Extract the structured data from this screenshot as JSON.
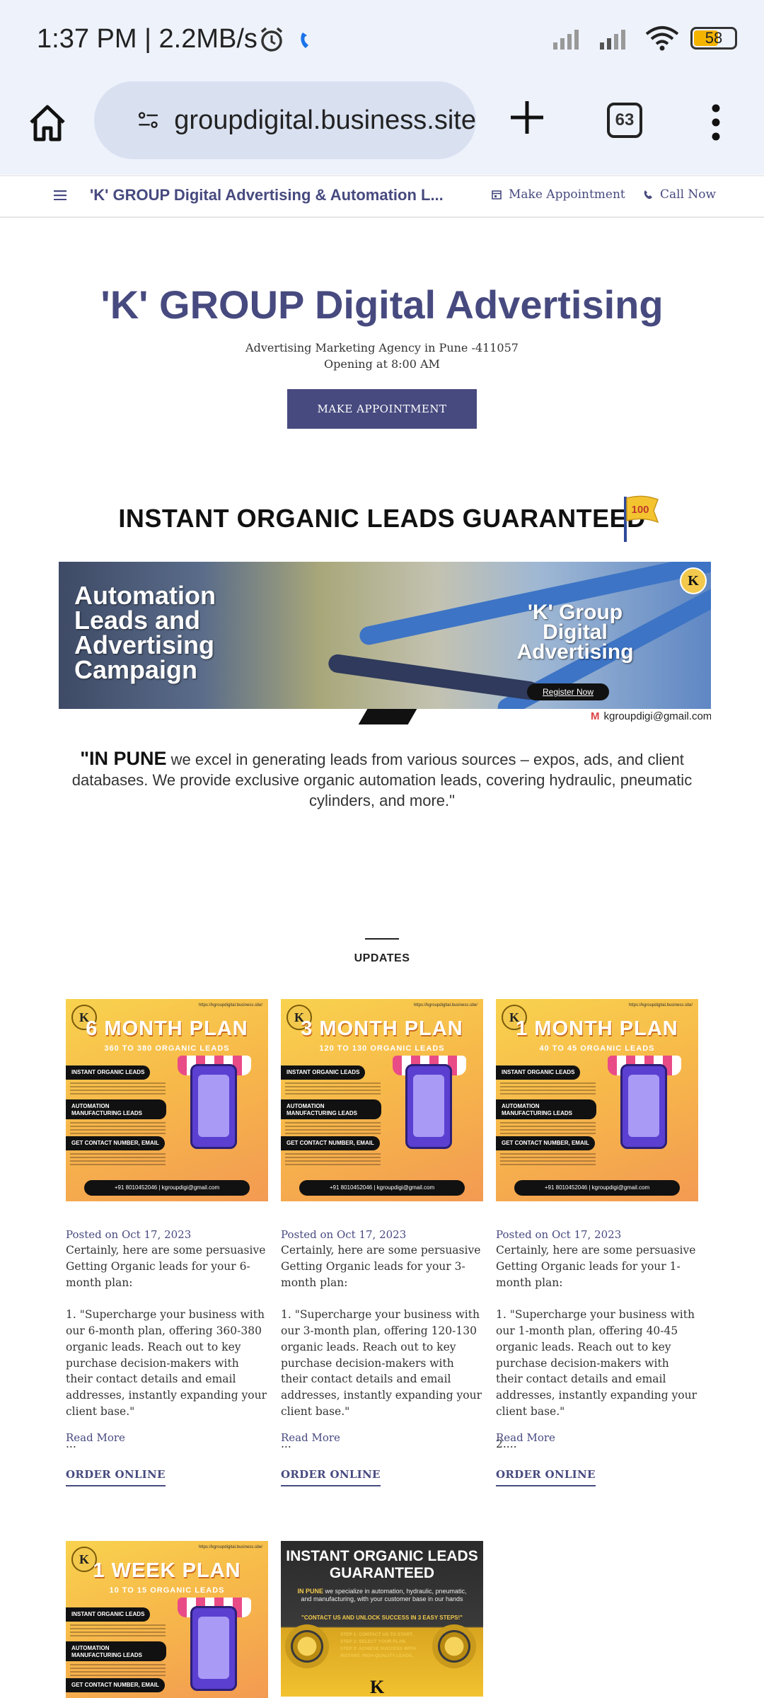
{
  "status_bar": {
    "time": "1:37 PM | 2.2MB/s",
    "battery": "58"
  },
  "browser": {
    "url": "groupdigital.business.site",
    "tab_count": "63"
  },
  "site_nav": {
    "title": "'K' GROUP Digital Advertising & Automation L...",
    "make_appointment": "Make Appointment",
    "call_now": "Call Now"
  },
  "hero": {
    "title": "'K' GROUP Digital Advertising",
    "subtitle": "Advertising Marketing Agency in Pune -411057",
    "opening": "Opening at 8:00 AM",
    "button": "MAKE APPOINTMENT"
  },
  "promo": {
    "heading": "INSTANT ORGANIC LEADS GUARANTEED",
    "flag_text": "100",
    "banner_left": "Automation Leads and Advertising Campaign",
    "banner_right": "'K' Group Digital Advertising",
    "banner_button": "Register Now",
    "banner_email": "kgroupdigi@gmail.com",
    "banner_logo": "K",
    "pune_lead": "\"IN PUNE",
    "pune_text": " we excel in generating leads from various sources – expos, ads, and client databases. We provide exclusive organic automation leads, covering hydraulic, pneumatic cylinders, and more.\""
  },
  "updates": {
    "label": "UPDATES",
    "posts": [
      {
        "plan_title": "6 MONTH PLAN",
        "plan_sub": "360 TO 380 ORGANIC LEADS",
        "date": "Posted on Oct 17, 2023",
        "body": "Certainly, here are some persuasive Getting Organic leads for your 6-month plan:\n\n1. \"Supercharge your business with our 6-month plan, offering 360-380 organic leads. Reach out to key purchase decision-makers with their contact details and email addresses, instantly expanding your client base.\"\n\n...",
        "read_more": "Read More",
        "order": "ORDER ONLINE"
      },
      {
        "plan_title": "3 MONTH PLAN",
        "plan_sub": "120 TO 130 ORGANIC LEADS",
        "date": "Posted on Oct 17, 2023",
        "body": "Certainly, here are some persuasive Getting Organic leads for your 3-month plan:\n\n1. \"Supercharge your business with our 3-month plan, offering 120-130 organic leads. Reach out to key purchase decision-makers with their contact details and email addresses, instantly expanding your client base.\"\n\n...",
        "read_more": "Read More",
        "order": "ORDER ONLINE"
      },
      {
        "plan_title": "1 MONTH PLAN",
        "plan_sub": "40 TO 45 ORGANIC LEADS",
        "date": "Posted on Oct 17, 2023",
        "body": "Certainly, here are some persuasive Getting Organic leads for your 1-month plan:\n\n1. \"Supercharge your business with our 1-month plan, offering 40-45 organic leads. Reach out to key purchase decision-makers with their contact details and email addresses, instantly expanding your client base.\"\n\n2....",
        "read_more": "Read More",
        "order": "ORDER ONLINE"
      }
    ],
    "poster_labels": {
      "instant": "INSTANT ORGANIC LEADS",
      "automation": "AUTOMATION MANUFACTURING LEADS",
      "contact": "GET CONTACT NUMBER, EMAIL",
      "footer": "+91 8010452046 | kgroupdigi@gmail.com",
      "logo": "K",
      "url": "https://kgroupdigital.business.site/"
    },
    "week_plan": {
      "plan_title": "1 WEEK PLAN",
      "plan_sub": "10 TO 15 ORGANIC LEADS"
    },
    "dark_card": {
      "title": "INSTANT ORGANIC LEADS GUARANTEED",
      "body_lead": "IN PUNE",
      "body": " we specialize in automation, hydraulic, pneumatic, and manufacturing, with your customer base in our hands",
      "cta": "\"CONTACT US AND UNLOCK SUCCESS IN 3 EASY STEPS!\"",
      "step1": "STEP 1: CONTACT US TO START.",
      "step2": "STEP 2: SELECT YOUR PLAN.",
      "step3": "STEP 3: ACHIEVE SUCCESS WITH INSTANT, HIGH-QUALITY LEADS.",
      "logo": "K"
    }
  }
}
